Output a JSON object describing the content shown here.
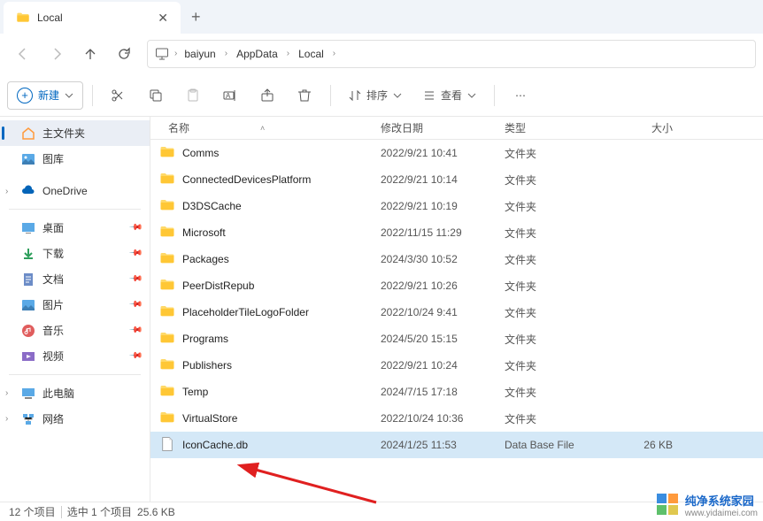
{
  "tab": {
    "title": "Local"
  },
  "breadcrumbs": [
    "baiyun",
    "AppData",
    "Local"
  ],
  "toolbar": {
    "new": "新建",
    "sort": "排序",
    "view": "查看"
  },
  "sidebar": {
    "main_folder": "主文件夹",
    "gallery": "图库",
    "onedrive": "OneDrive",
    "quick": [
      "桌面",
      "下载",
      "文档",
      "图片",
      "音乐",
      "视频"
    ],
    "this_pc": "此电脑",
    "network": "网络"
  },
  "columns": {
    "name": "名称",
    "date": "修改日期",
    "type": "类型",
    "size": "大小"
  },
  "files": [
    {
      "name": "Comms",
      "date": "2022/9/21 10:41",
      "type": "文件夹",
      "size": "",
      "kind": "folder"
    },
    {
      "name": "ConnectedDevicesPlatform",
      "date": "2022/9/21 10:14",
      "type": "文件夹",
      "size": "",
      "kind": "folder"
    },
    {
      "name": "D3DSCache",
      "date": "2022/9/21 10:19",
      "type": "文件夹",
      "size": "",
      "kind": "folder"
    },
    {
      "name": "Microsoft",
      "date": "2022/11/15 11:29",
      "type": "文件夹",
      "size": "",
      "kind": "folder"
    },
    {
      "name": "Packages",
      "date": "2024/3/30 10:52",
      "type": "文件夹",
      "size": "",
      "kind": "folder"
    },
    {
      "name": "PeerDistRepub",
      "date": "2022/9/21 10:26",
      "type": "文件夹",
      "size": "",
      "kind": "folder"
    },
    {
      "name": "PlaceholderTileLogoFolder",
      "date": "2022/10/24 9:41",
      "type": "文件夹",
      "size": "",
      "kind": "folder"
    },
    {
      "name": "Programs",
      "date": "2024/5/20 15:15",
      "type": "文件夹",
      "size": "",
      "kind": "folder"
    },
    {
      "name": "Publishers",
      "date": "2022/9/21 10:24",
      "type": "文件夹",
      "size": "",
      "kind": "folder"
    },
    {
      "name": "Temp",
      "date": "2024/7/15 17:18",
      "type": "文件夹",
      "size": "",
      "kind": "folder"
    },
    {
      "name": "VirtualStore",
      "date": "2022/10/24 10:36",
      "type": "文件夹",
      "size": "",
      "kind": "folder"
    },
    {
      "name": "IconCache.db",
      "date": "2024/1/25 11:53",
      "type": "Data Base File",
      "size": "26 KB",
      "kind": "file",
      "selected": true
    }
  ],
  "status": {
    "count": "12 个项目",
    "selected": "选中 1 个项目",
    "size": "25.6 KB"
  },
  "watermark": {
    "title": "纯净系统家园",
    "url": "www.yidaimei.com"
  }
}
